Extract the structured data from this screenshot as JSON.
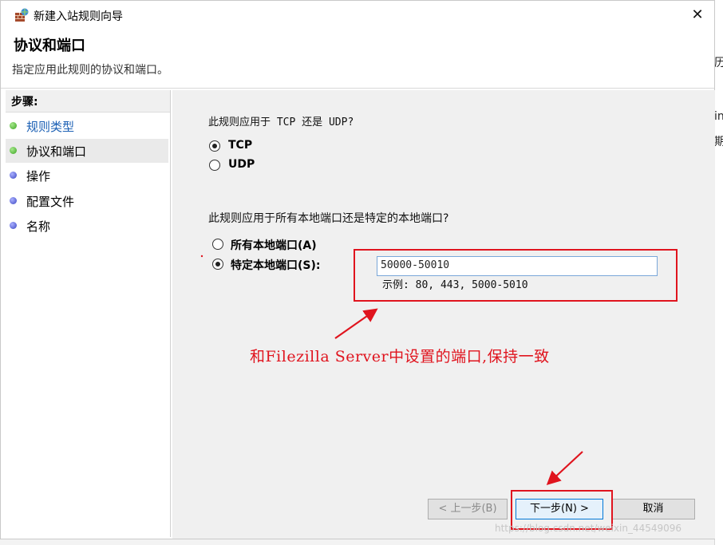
{
  "window": {
    "title": "新建入站规则向导",
    "close_glyph": "✕"
  },
  "header": {
    "title": "协议和端口",
    "description": "指定应用此规则的协议和端口。"
  },
  "steps": {
    "heading": "步骤:",
    "items": [
      {
        "label": "规则类型",
        "dot": "green"
      },
      {
        "label": "协议和端口",
        "dot": "green"
      },
      {
        "label": "操作",
        "dot": "blue"
      },
      {
        "label": "配置文件",
        "dot": "blue"
      },
      {
        "label": "名称",
        "dot": "blue"
      }
    ]
  },
  "protocol": {
    "question": "此规则应用于 TCP 还是 UDP?",
    "options": [
      {
        "label": "TCP",
        "selected": true
      },
      {
        "label": "UDP",
        "selected": false
      }
    ]
  },
  "ports": {
    "question": "此规则应用于所有本地端口还是特定的本地端口?",
    "options": [
      {
        "label": "所有本地端口(A)",
        "selected": false
      },
      {
        "label": "特定本地端口(S):",
        "selected": true
      }
    ],
    "value": "50000-50010",
    "example": "示例: 80, 443, 5000-5010"
  },
  "annotation": {
    "text": "和Filezilla Server中设置的端口,保持一致",
    "color": "#e0141e"
  },
  "buttons": {
    "back": "< 上一步(B)",
    "next": "下一步(N) >",
    "cancel": "取消"
  },
  "background_fragments": [
    "历",
    "in",
    "期"
  ],
  "watermark": "https://blog.csdn.net/weixin_44549096"
}
